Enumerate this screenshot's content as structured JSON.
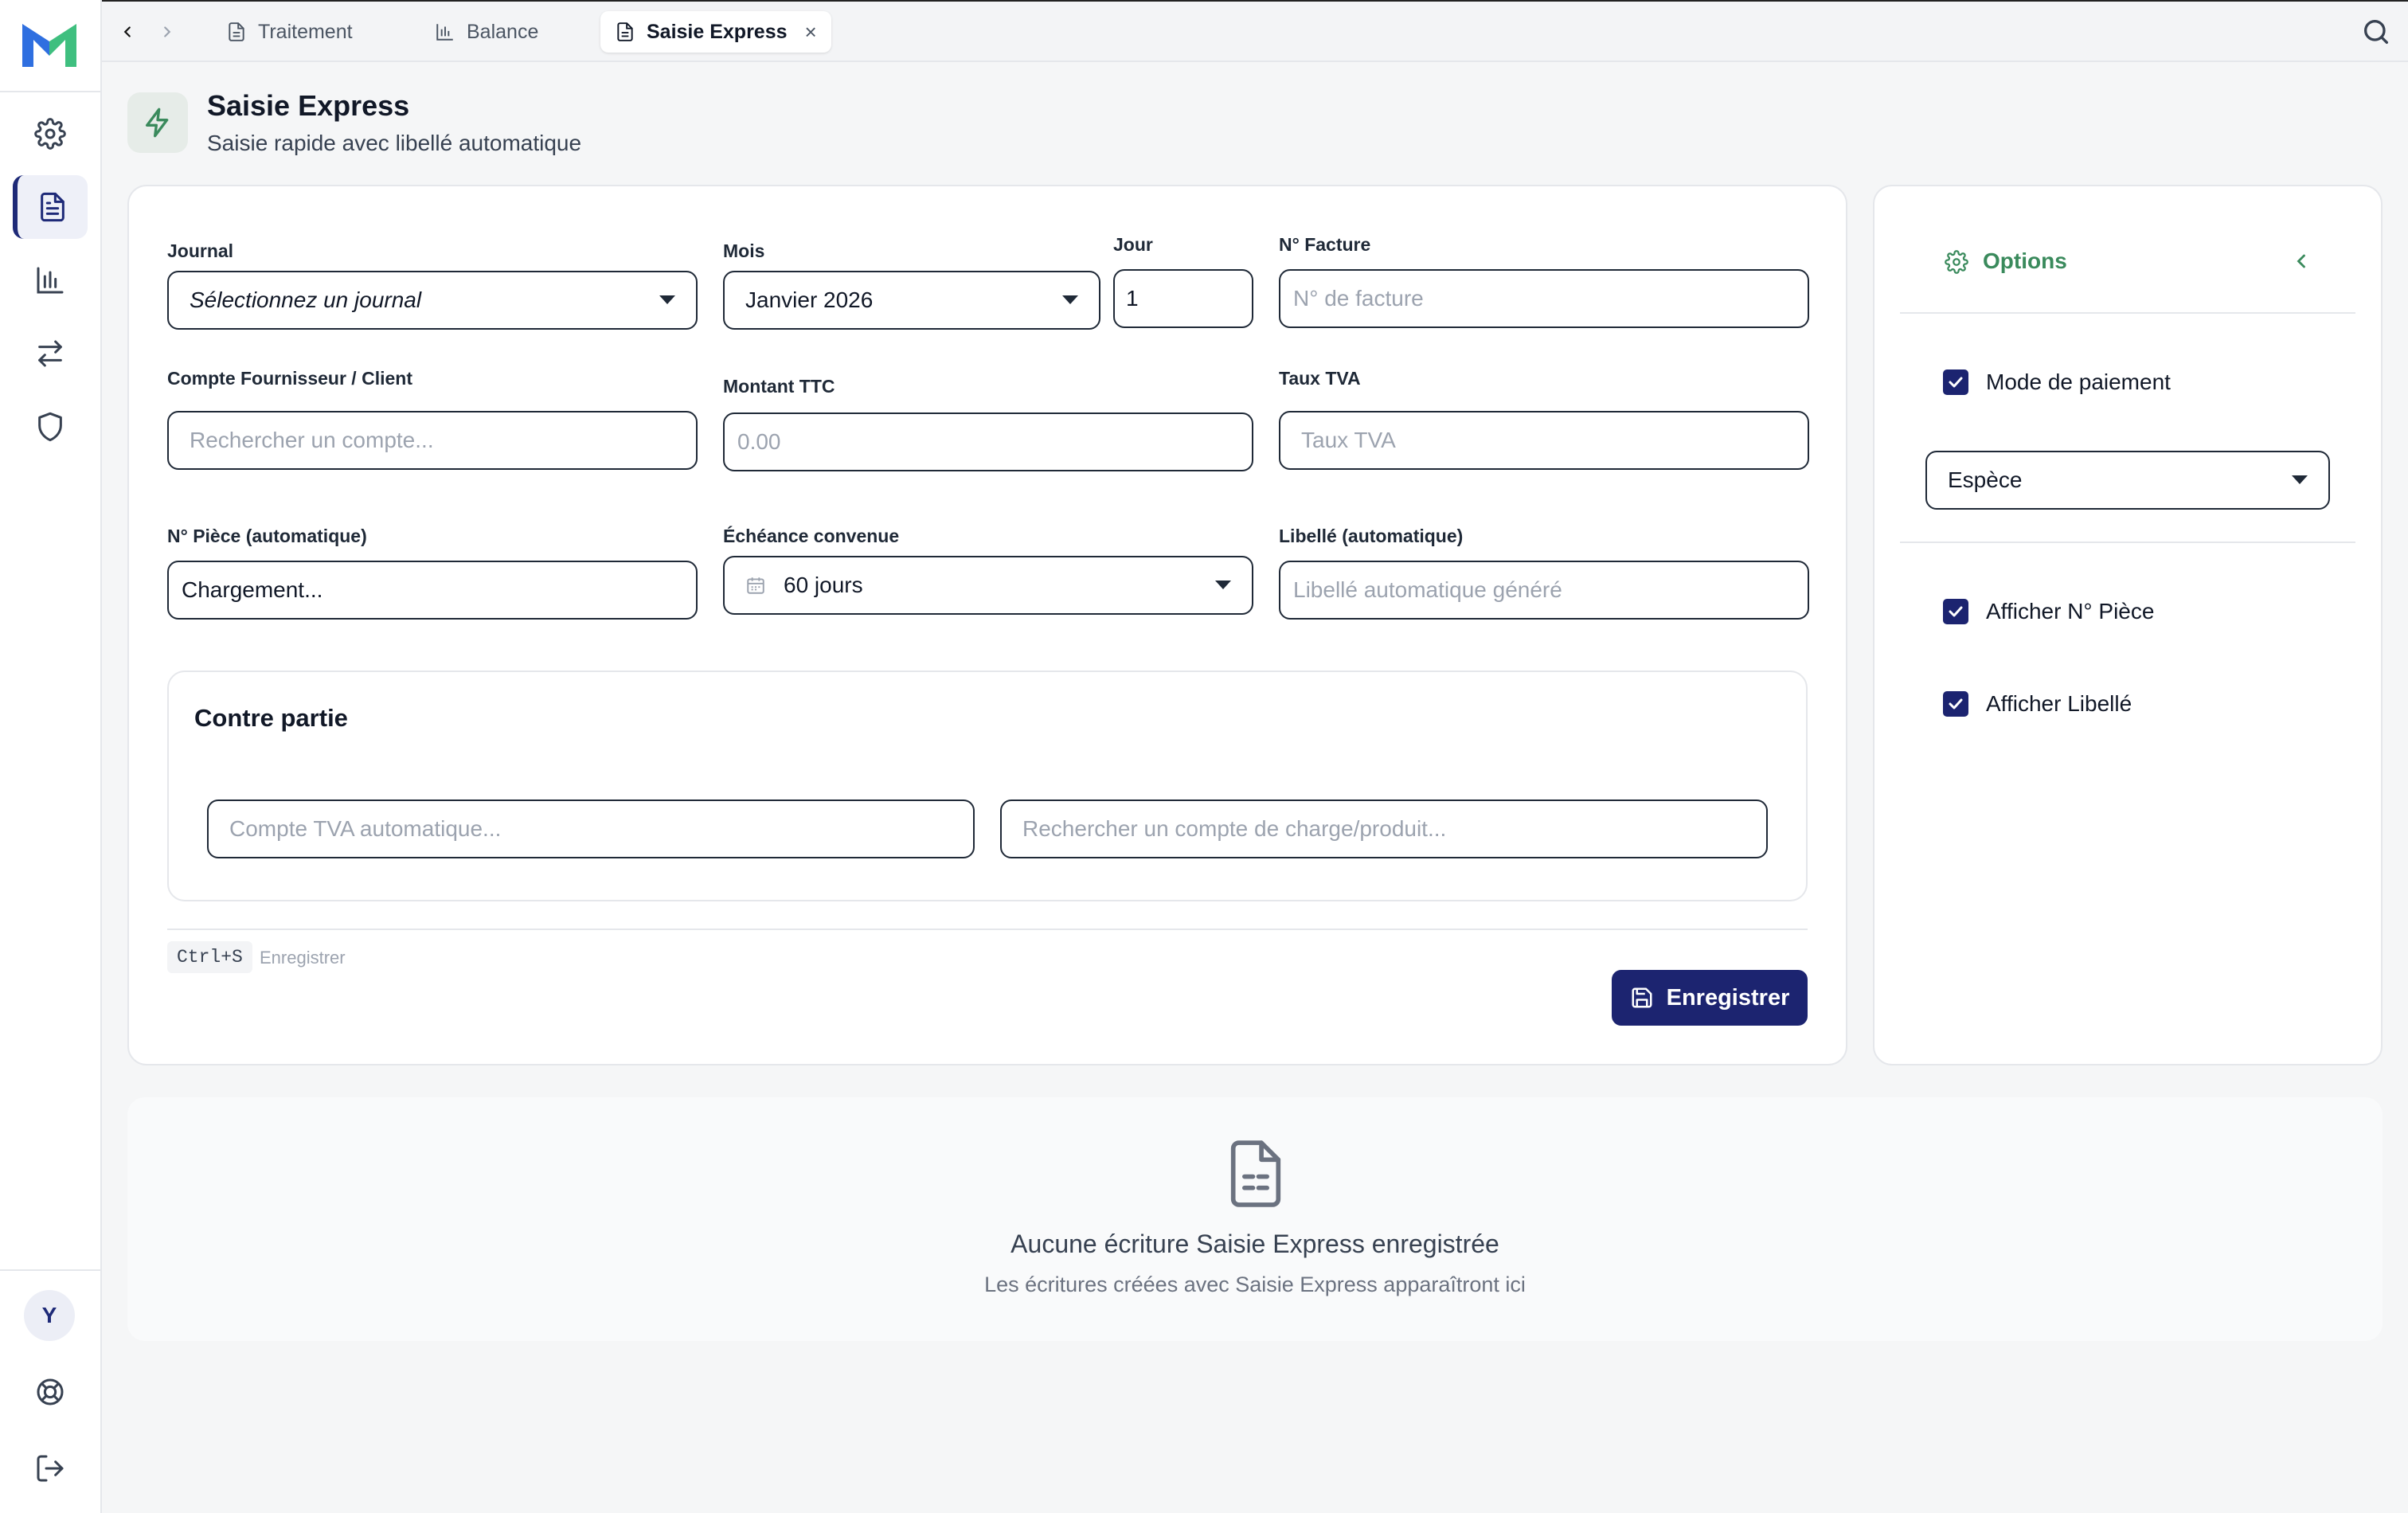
{
  "tabs": [
    {
      "label": "Traitement",
      "icon": "document-icon",
      "active": false
    },
    {
      "label": "Balance",
      "icon": "bar-chart-icon",
      "active": false
    },
    {
      "label": "Saisie Express",
      "icon": "document-icon",
      "active": true,
      "close": "×"
    }
  ],
  "header": {
    "title": "Saisie Express",
    "subtitle": "Saisie rapide avec libellé automatique"
  },
  "form": {
    "journal": {
      "label": "Journal",
      "value": "Sélectionnez un journal"
    },
    "mois": {
      "label": "Mois",
      "value": "Janvier 2026"
    },
    "jour": {
      "label": "Jour",
      "value": "1"
    },
    "facture": {
      "label": "N° Facture",
      "placeholder": "N° de facture"
    },
    "compte": {
      "label": "Compte Fournisseur / Client",
      "placeholder": "Rechercher un compte..."
    },
    "montant": {
      "label": "Montant TTC",
      "placeholder": "0.00"
    },
    "tva": {
      "label": "Taux TVA",
      "placeholder": "Taux TVA"
    },
    "piece": {
      "label": "N° Pièce (automatique)",
      "value": "Chargement..."
    },
    "echeance": {
      "label": "Échéance convenue",
      "value": "60 jours"
    },
    "libelle": {
      "label": "Libellé (automatique)",
      "placeholder": "Libellé automatique généré"
    }
  },
  "contre_partie": {
    "title": "Contre partie",
    "tva_placeholder": "Compte TVA automatique...",
    "charge_placeholder": "Rechercher un compte de charge/produit..."
  },
  "shortcut": {
    "keys": "Ctrl+S",
    "label": "Enregistrer"
  },
  "save_label": "Enregistrer",
  "options": {
    "title": "Options",
    "mode_paiement": {
      "label": "Mode de paiement",
      "checked": true
    },
    "mode_value": "Espèce",
    "afficher_piece": {
      "label": "Afficher N° Pièce",
      "checked": true
    },
    "afficher_libelle": {
      "label": "Afficher Libellé",
      "checked": true
    }
  },
  "empty": {
    "title": "Aucune écriture Saisie Express enregistrée",
    "subtitle": "Les écritures créées avec Saisie Express apparaîtront ici"
  },
  "user": {
    "initial": "Y"
  },
  "colors": {
    "accent": "#1c2470",
    "green": "#3a8a5c"
  }
}
